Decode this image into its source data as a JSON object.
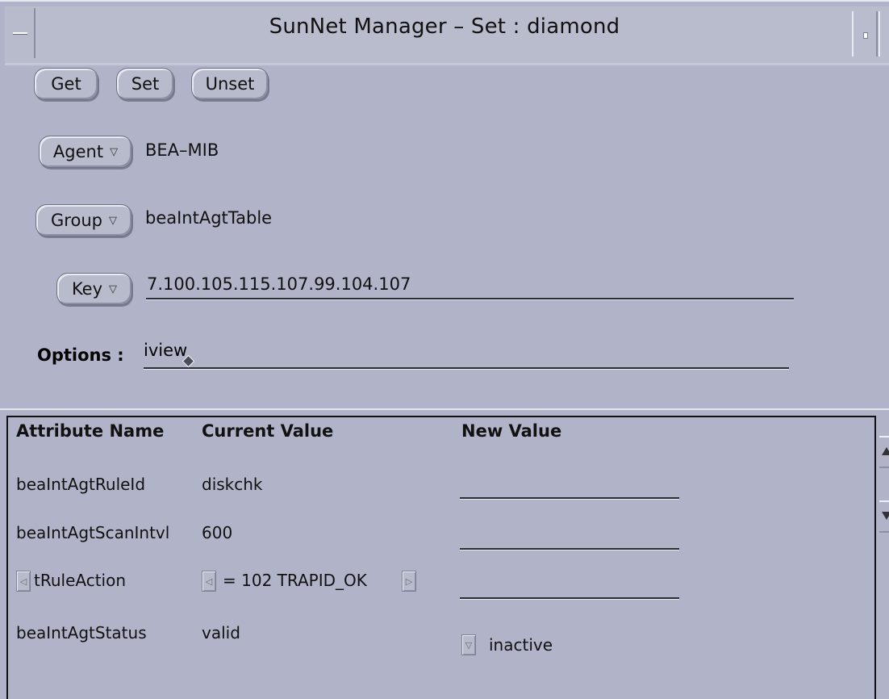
{
  "window": {
    "title": "SunNet Manager – Set : diamond"
  },
  "toolbar": {
    "get_label": "Get",
    "set_label": "Set",
    "unset_label": "Unset"
  },
  "agent": {
    "button_label": "Agent",
    "value": "BEA–MIB"
  },
  "group": {
    "button_label": "Group",
    "value": "beaIntAgtTable"
  },
  "key": {
    "button_label": "Key",
    "value": "7.100.105.115.107.99.104.107"
  },
  "options": {
    "label": "Options :",
    "value": "iview"
  },
  "table": {
    "headers": {
      "attribute": "Attribute Name",
      "current": "Current Value",
      "new": "New Value"
    },
    "rows": [
      {
        "name": "beaIntAgtRuleId",
        "current": "diskchk",
        "new": ""
      },
      {
        "name": "beaIntAgtScanIntvl",
        "current": "600",
        "new": ""
      },
      {
        "name": "tRuleAction",
        "current": "= 102 TRAPID_OK",
        "new": ""
      },
      {
        "name": "beaIntAgtStatus",
        "current": "valid",
        "new": "inactive"
      }
    ]
  },
  "icons": {
    "window_menu": "window-menu-icon",
    "resize": "resize-icon",
    "dropdown": "triangle-down-icon",
    "scroll_left": "arrow-left-icon",
    "scroll_right": "arrow-right-icon",
    "scroll_up": "arrow-up-icon",
    "scroll_down": "arrow-down-icon"
  },
  "colors": {
    "background": "#b1b4c8",
    "text": "#111111"
  }
}
